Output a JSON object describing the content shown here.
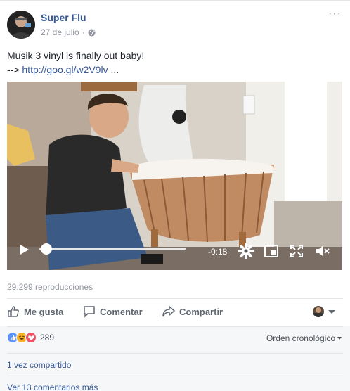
{
  "post": {
    "author": "Super Flu",
    "date": "27 de julio",
    "date_separator": "·",
    "more_label": "···",
    "text_line1": "Musik 3 vinyl is finally out baby!",
    "text_prefix": "--> ",
    "link_text": "http://goo.gl/w2V9lv",
    "link_suffix": " ..."
  },
  "video": {
    "remaining_time": "-0:18",
    "progress": 0.0
  },
  "views": "29.299 reproducciones",
  "actions": {
    "like": "Me gusta",
    "comment": "Comentar",
    "share": "Compartir"
  },
  "reactions": {
    "count": "289",
    "types": [
      "like-icon",
      "haha-icon",
      "love-icon"
    ],
    "colors": {
      "like": "#5890ff",
      "haha": "#f7b125",
      "love": "#f25268"
    }
  },
  "comments": {
    "order": "Orden cronológico",
    "shared": "1 vez compartido",
    "more": "Ver 13 comentarios más"
  },
  "colors": {
    "link": "#365899",
    "muted": "#90949c",
    "action": "#606770"
  }
}
